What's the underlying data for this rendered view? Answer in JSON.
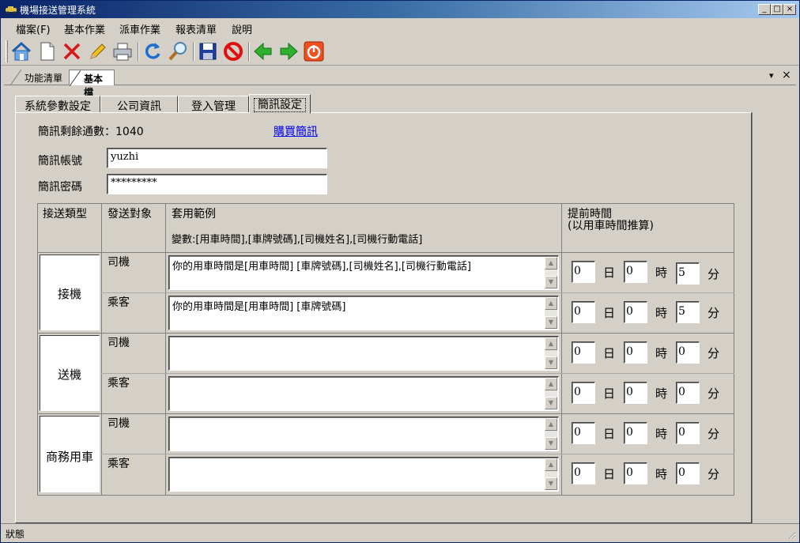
{
  "window": {
    "title": "機場接送管理系統",
    "controls": [
      "_",
      "□",
      "×"
    ]
  },
  "menu": [
    "檔案(F)",
    "基本作業",
    "派車作業",
    "報表清單",
    "說明"
  ],
  "toolbar": {
    "buttons": [
      "home-icon",
      "new-document-icon",
      "delete-icon",
      "edit-icon",
      "print-icon",
      "refresh-icon",
      "search-icon",
      "save-icon",
      "cancel-icon",
      "previous-icon",
      "next-icon",
      "power-icon"
    ]
  },
  "doc_tabs": [
    {
      "label": "功能清單",
      "active": false
    },
    {
      "label": "基本檔",
      "active": true
    }
  ],
  "doc_strip_controls": {
    "dropdown": "▾",
    "close": "×"
  },
  "tabs": [
    {
      "label": "系統參數設定"
    },
    {
      "label": "公司資訊"
    },
    {
      "label": "登入管理"
    },
    {
      "label": "簡訊設定",
      "selected": true
    }
  ],
  "sms": {
    "remaining_label": "簡訊剩餘通數：1040",
    "buy_link": "購買簡訊",
    "account_label": "簡訊帳號",
    "account_value": "yuzhi",
    "password_label": "簡訊密碼",
    "password_value": "*********"
  },
  "grid": {
    "headers": {
      "type": "接送類型",
      "target": "發送對象",
      "template": "套用範例",
      "variables": "變數:[用車時間],[車牌號碼],[司機姓名],[司機行動電話]",
      "advance": "提前時間",
      "advance_note": "(以用車時間推算)"
    },
    "units": {
      "day": "日",
      "hour": "時",
      "minute": "分"
    },
    "groups": [
      {
        "type": "接機",
        "rows": [
          {
            "target": "司機",
            "message": "你的用車時間是[用車時間] [車牌號碼],[司機姓名],[司機行動電話]",
            "day": "0",
            "hour": "0",
            "minute": "5"
          },
          {
            "target": "乘客",
            "message": "你的用車時間是[用車時間] [車牌號碼]",
            "day": "0",
            "hour": "0",
            "minute": "5"
          }
        ]
      },
      {
        "type": "送機",
        "rows": [
          {
            "target": "司機",
            "message": "",
            "day": "0",
            "hour": "0",
            "minute": "0"
          },
          {
            "target": "乘客",
            "message": "",
            "day": "0",
            "hour": "0",
            "minute": "0"
          }
        ]
      },
      {
        "type": "商務用車",
        "rows": [
          {
            "target": "司機",
            "message": "",
            "day": "0",
            "hour": "0",
            "minute": "0"
          },
          {
            "target": "乘客",
            "message": "",
            "day": "0",
            "hour": "0",
            "minute": "0"
          }
        ]
      }
    ]
  },
  "status": "狀態"
}
